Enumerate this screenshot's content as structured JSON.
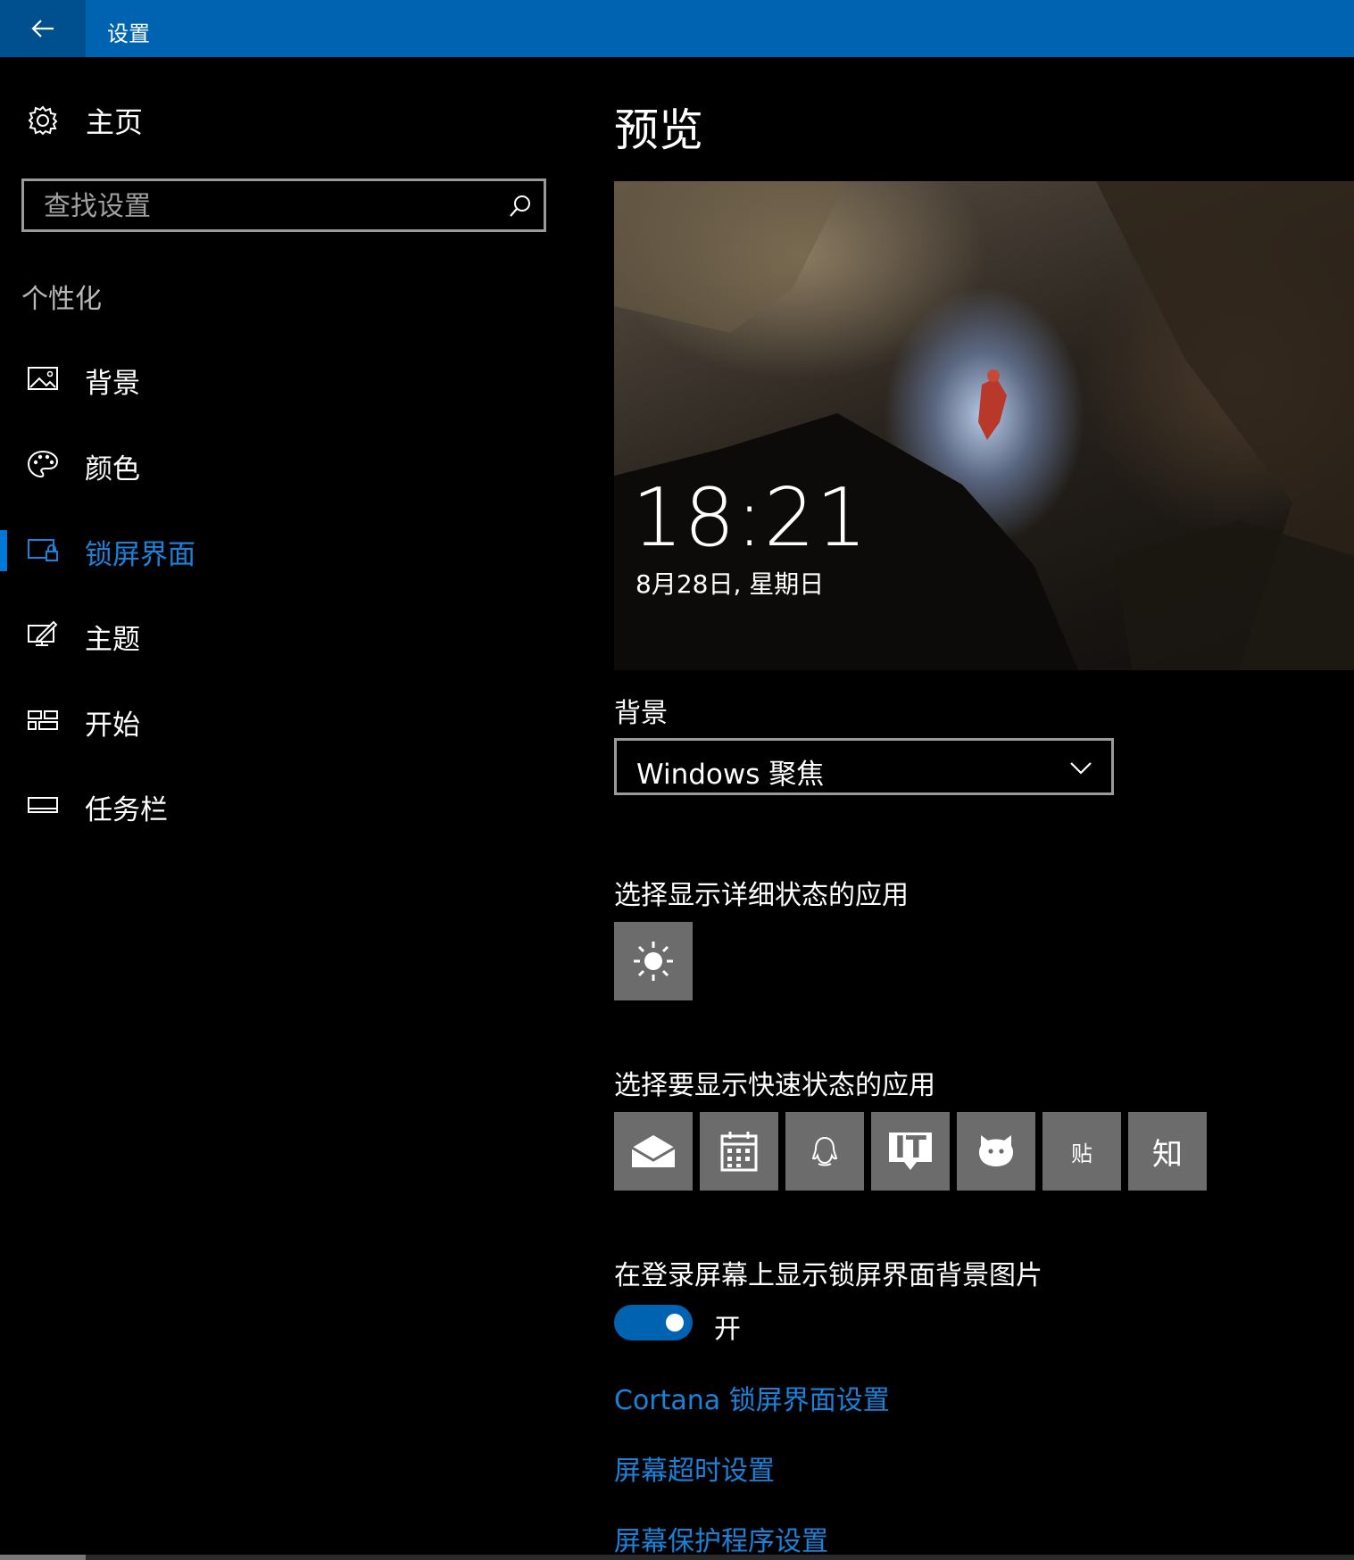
{
  "window": {
    "title": "设置"
  },
  "sidebar": {
    "home_label": "主页",
    "search_placeholder": "查找设置",
    "section": "个性化",
    "items": [
      {
        "label": "背景",
        "icon": "image-icon"
      },
      {
        "label": "颜色",
        "icon": "palette-icon"
      },
      {
        "label": "锁屏界面",
        "icon": "lock-screen-icon",
        "active": true
      },
      {
        "label": "主题",
        "icon": "theme-icon"
      },
      {
        "label": "开始",
        "icon": "start-icon"
      },
      {
        "label": "任务栏",
        "icon": "taskbar-icon"
      }
    ]
  },
  "main": {
    "preview_heading": "预览",
    "preview_time": "18:21",
    "preview_date": "8月28日, 星期日",
    "background_label": "背景",
    "background_value": "Windows 聚焦",
    "detail_label": "选择显示详细状态的应用",
    "detail_app": "weather-icon",
    "quick_label": "选择要显示快速状态的应用",
    "quick_apps": [
      {
        "icon": "mail-icon"
      },
      {
        "icon": "calendar-icon"
      },
      {
        "icon": "qq-icon"
      },
      {
        "icon": "ithome-icon",
        "text": "IT"
      },
      {
        "icon": "chat-bubble-icon"
      },
      {
        "icon": "tieba-icon",
        "text": "贴"
      },
      {
        "icon": "zhihu-icon",
        "text": "知"
      }
    ],
    "login_label": "在登录屏幕上显示锁屏界面背景图片",
    "toggle_state": "开",
    "links": [
      "Cortana 锁屏界面设置",
      "屏幕超时设置",
      "屏幕保护程序设置"
    ]
  },
  "colors": {
    "accent": "#0063b1",
    "link": "#1a82d8",
    "tile": "#6c6c6c"
  }
}
